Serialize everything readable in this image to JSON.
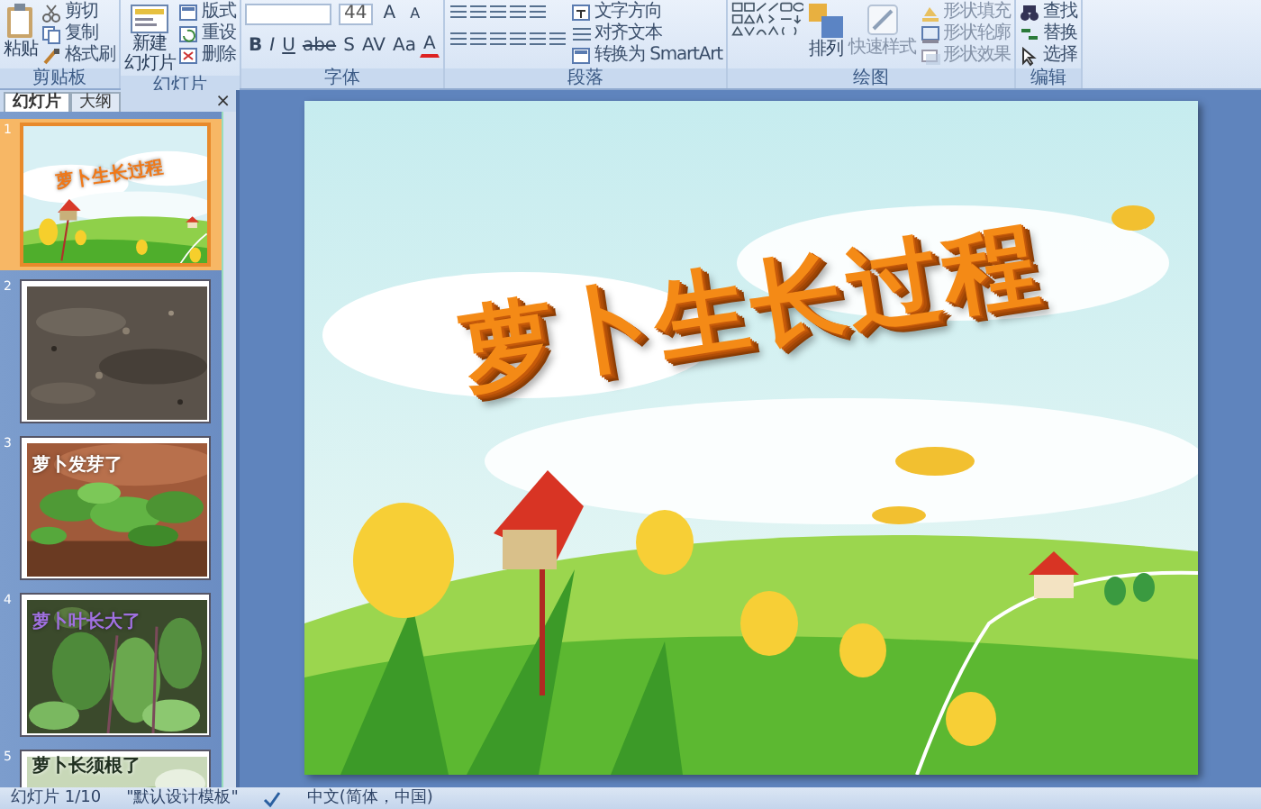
{
  "ribbon": {
    "clipboard": {
      "label": "剪贴板",
      "paste": "粘贴",
      "small": [
        "剪切",
        "复制",
        "格式刷"
      ]
    },
    "slides": {
      "label": "幻灯片",
      "new_slide": [
        "新建",
        "幻灯片"
      ],
      "small": [
        "版式",
        "重设",
        "删除"
      ]
    },
    "font": {
      "label": "字体",
      "size": "44",
      "grow_shrink": [
        "A",
        "A"
      ],
      "buttons": [
        "B",
        "I",
        "U",
        "abe",
        "S",
        "AV",
        "Aa",
        "A"
      ]
    },
    "paragraph": {
      "label": "段落",
      "small": [
        "文字方向",
        "对齐文本",
        "转换为 SmartArt"
      ]
    },
    "drawing": {
      "label": "绘图",
      "arrange": "排列",
      "quick_styles": "快速样式",
      "small": [
        "形状填充",
        "形状轮廓",
        "形状效果"
      ]
    },
    "editing": {
      "label": "编辑",
      "small": [
        "查找",
        "替换",
        "选择"
      ]
    }
  },
  "panel": {
    "tabs": [
      {
        "label": "幻灯片",
        "selected": true
      },
      {
        "label": "大纲",
        "selected": false
      }
    ],
    "close": "×",
    "thumbnails": [
      {
        "number": "1",
        "selected": true,
        "caption": "萝卜生长过程",
        "color": "#f07818"
      },
      {
        "number": "2",
        "selected": false
      },
      {
        "number": "3",
        "selected": false,
        "caption": "萝卜发芽了",
        "color": "#ffffff"
      },
      {
        "number": "4",
        "selected": false,
        "caption": "萝卜叶长大了",
        "color": "#a070e0"
      },
      {
        "number": "5",
        "selected": false,
        "caption": "萝卜长须根了",
        "color": "#203020"
      }
    ]
  },
  "slide": {
    "title": "萝卜生长过程"
  },
  "status_bar": {
    "slide": "幻灯片 1/10",
    "theme": "\"默认设计模板\"",
    "language": "中文(简体，中国)"
  }
}
